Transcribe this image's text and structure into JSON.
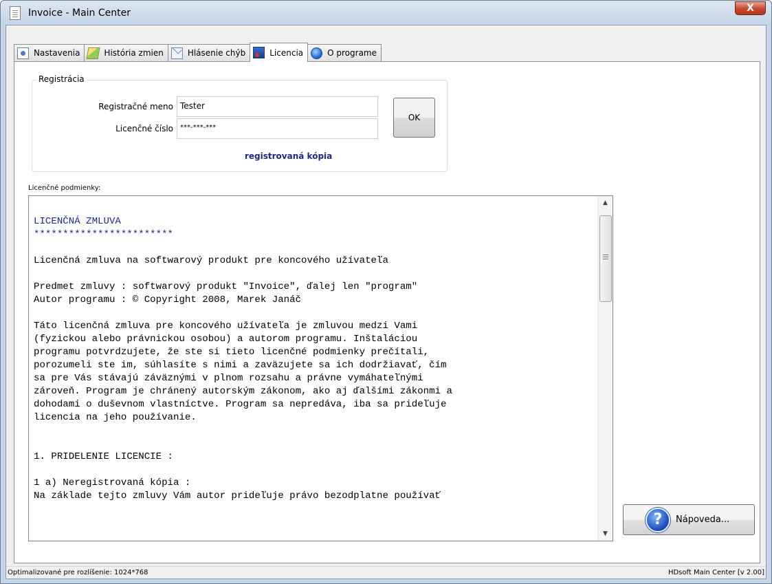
{
  "window": {
    "title": "Invoice - Main Center",
    "close_label": "X"
  },
  "tabs": [
    {
      "label": "Nastavenia",
      "icon": "settings-icon",
      "active": false
    },
    {
      "label": "História zmien",
      "icon": "history-icon",
      "active": false
    },
    {
      "label": "Hlásenie chýb",
      "icon": "mail-icon",
      "active": false
    },
    {
      "label": "Licencia",
      "icon": "licence-icon",
      "active": true
    },
    {
      "label": "O programe",
      "icon": "info-icon",
      "active": false
    }
  ],
  "registration": {
    "group_title": "Registrácia",
    "name_label": "Registračné meno",
    "name_value": "Tester",
    "number_label": "Licenčné číslo",
    "number_value": "***-***-***",
    "ok_label": "OK",
    "status": "registrovaná kópia"
  },
  "license": {
    "label": "Licenčné podmienky:",
    "lines": [
      "LICENČNÁ ZMLUVA",
      "************************",
      "",
      "Licenčná zmluva na softwarový produkt pre koncového užívateľa",
      "",
      "Predmet zmluvy : softwarový produkt \"Invoice\", ďalej len \"program\"",
      "Autor programu : © Copyright 2008, Marek Janáč",
      "",
      "Táto licenčná zmluva pre koncového užívateľa je zmluvou medzi Vami",
      "(fyzickou alebo právnickou osobou) a autorom programu. Inštaláciou",
      "programu potvrdzujete, že ste si tieto licenčné podmienky prečítali,",
      "porozumeli ste im, súhlasíte s nimi a zaväzujete sa ich dodržiavať, čím",
      "sa pre Vás stávajú záväznými v plnom rozsahu a právne vymáhateľnými",
      "zároveň. Program je chránený autorským zákonom, ako aj ďalšími zákonmi a",
      "dohodami o duševnom vlastníctve. Program sa nepredáva, iba sa prideľuje",
      "licencia na jeho používanie.",
      "",
      "",
      "1. PRIDELENIE LICENCIE :",
      "",
      "1 a) Neregistrovaná kópia :",
      "Na základe tejto zmluvy Vám autor prideľuje právo bezodplatne používať"
    ]
  },
  "help_button": {
    "label": "Nápoveda...",
    "icon": "help-icon"
  },
  "statusbar": {
    "left": "Optimalizované pre rozlíšenie: 1024*768",
    "right": "HDsoft Main Center [v 2.00]"
  }
}
